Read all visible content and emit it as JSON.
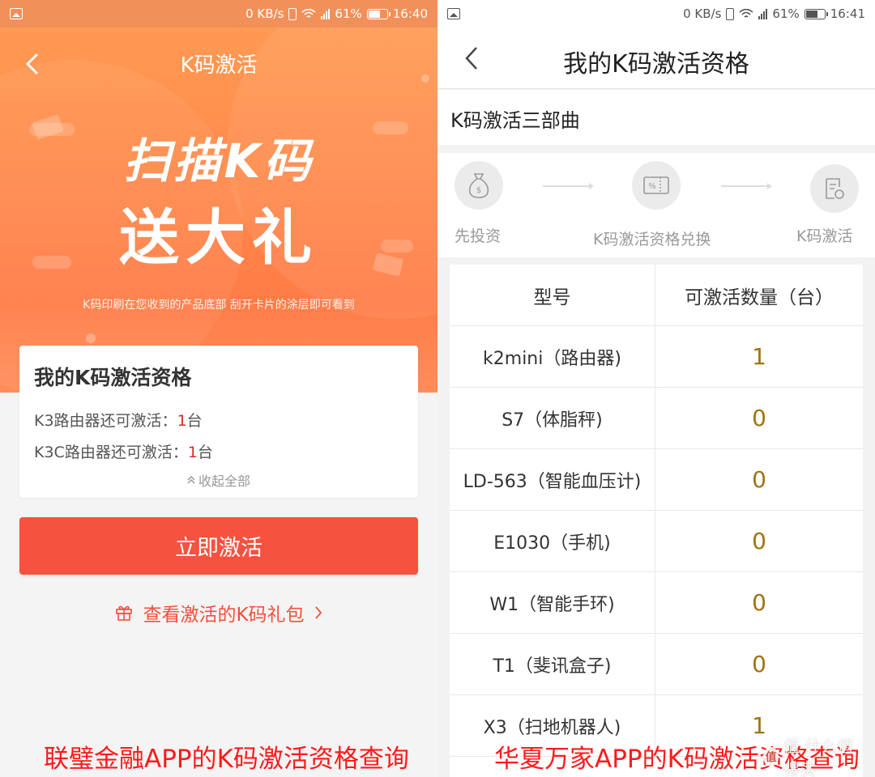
{
  "left_screen": {
    "status": {
      "speed": "0 KB/s",
      "network": "4G\n2G",
      "battery": "61%",
      "time": "16:40"
    },
    "title": "K码激活",
    "promo_line1": "扫描K码",
    "promo_line2": "送大礼",
    "tip": "K码印刷在您收到的产品底部  刮开卡片的涂层即可看到",
    "qualification": {
      "title": "我的K码激活资格",
      "items": [
        {
          "prefix": "K3路由器还可激活：",
          "count": "1",
          "unit": "台"
        },
        {
          "prefix": "K3C路由器还可激活：",
          "count": "1",
          "unit": "台"
        }
      ],
      "collapse_label": "收起全部"
    },
    "activate_button": "立即激活",
    "gift_link": "查看激活的K码礼包",
    "caption": "联璧金融APP的K码激活资格查询"
  },
  "right_screen": {
    "status": {
      "speed": "0 KB/s",
      "network": "4G\n2G",
      "battery": "61%",
      "time": "16:41"
    },
    "title": "我的K码激活资格",
    "section_title": "K码激活三部曲",
    "steps": [
      "先投资",
      "K码激活资格兑换",
      "K码激活"
    ],
    "table": {
      "headers": [
        "型号",
        "可激活数量（台）"
      ],
      "rows": [
        {
          "model": "k2mini（路由器)",
          "count": "1"
        },
        {
          "model": "S7（体脂秤)",
          "count": "0"
        },
        {
          "model": "LD-563（智能血压计)",
          "count": "0"
        },
        {
          "model": "E1030（手机)",
          "count": "0"
        },
        {
          "model": "W1（智能手环)",
          "count": "0"
        },
        {
          "model": "T1（斐讯盒子)",
          "count": "0"
        },
        {
          "model": "X3（扫地机器人)",
          "count": "1"
        }
      ]
    },
    "caption": "华夏万家APP的K码激活资格查询",
    "watermark": "值 什么值得买"
  },
  "colors": {
    "hero_orange": "#ff8a4b",
    "activate_red": "#f65240",
    "count_red": "#e0282d",
    "count_gold": "#a07314",
    "caption_red": "#ff1a1a"
  }
}
